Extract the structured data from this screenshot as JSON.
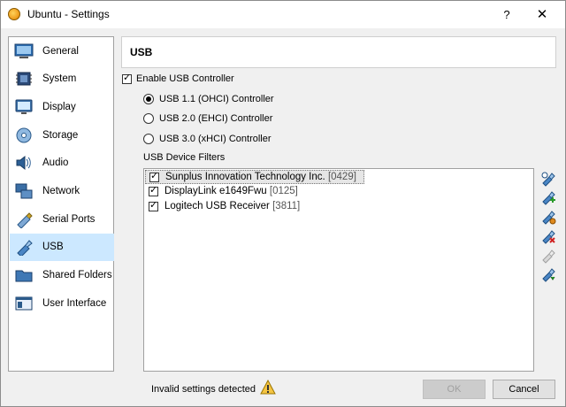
{
  "window": {
    "title": "Ubuntu - Settings",
    "help_label": "?",
    "close_label": "✕"
  },
  "sidebar": {
    "items": [
      {
        "label": "General",
        "icon": "general-icon"
      },
      {
        "label": "System",
        "icon": "system-icon"
      },
      {
        "label": "Display",
        "icon": "display-icon"
      },
      {
        "label": "Storage",
        "icon": "storage-icon"
      },
      {
        "label": "Audio",
        "icon": "audio-icon"
      },
      {
        "label": "Network",
        "icon": "network-icon"
      },
      {
        "label": "Serial Ports",
        "icon": "serial-ports-icon"
      },
      {
        "label": "USB",
        "icon": "usb-icon",
        "selected": true
      },
      {
        "label": "Shared Folders",
        "icon": "shared-folders-icon"
      },
      {
        "label": "User Interface",
        "icon": "user-interface-icon"
      }
    ]
  },
  "main": {
    "title": "USB",
    "enable_usb": {
      "label": "Enable USB Controller",
      "checked": true
    },
    "controllers": [
      {
        "label": "USB 1.1 (OHCI) Controller",
        "selected": true
      },
      {
        "label": "USB 2.0 (EHCI) Controller",
        "selected": false
      },
      {
        "label": "USB 3.0 (xHCI) Controller",
        "selected": false
      }
    ],
    "filters_label": "USB Device Filters",
    "filters": [
      {
        "name": "Sunplus Innovation Technology Inc.",
        "code": "[0429]",
        "checked": true,
        "selected": true
      },
      {
        "name": "DisplayLink e1649Fwu",
        "code": "[0125]",
        "checked": true,
        "selected": false
      },
      {
        "name": "Logitech USB Receiver",
        "code": "[3811]",
        "checked": true,
        "selected": false
      }
    ],
    "filter_actions": [
      {
        "name": "add-empty-filter",
        "icon": "usb-add-icon",
        "enabled": true
      },
      {
        "name": "add-filter-from-device",
        "icon": "usb-add-device-icon",
        "enabled": true
      },
      {
        "name": "edit-filter",
        "icon": "usb-edit-icon",
        "enabled": true
      },
      {
        "name": "remove-filter",
        "icon": "usb-remove-icon",
        "enabled": true
      },
      {
        "name": "move-filter-up",
        "icon": "usb-move-up-icon",
        "enabled": false
      },
      {
        "name": "move-filter-down",
        "icon": "usb-move-down-icon",
        "enabled": true
      }
    ]
  },
  "footer": {
    "status": "Invalid settings detected",
    "ok_label": "OK",
    "cancel_label": "Cancel",
    "ok_enabled": false
  },
  "colors": {
    "selection": "#cce8ff",
    "window_bg": "#f0f0f0"
  }
}
